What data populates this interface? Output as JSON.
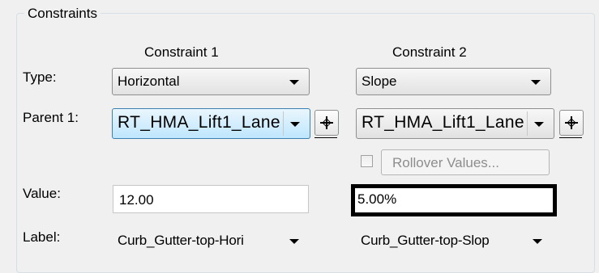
{
  "group": {
    "title": "Constraints"
  },
  "columns": {
    "c1": "Constraint 1",
    "c2": "Constraint 2"
  },
  "rows": {
    "type": {
      "label": "Type:",
      "c1": "Horizontal",
      "c2": "Slope"
    },
    "parent1": {
      "label": "Parent 1:",
      "c1": "RT_HMA_Lift1_Lanе",
      "c2": "RT_HMA_Lift1_Lanе"
    },
    "rollover": {
      "label": "Rollover Values..."
    },
    "value": {
      "label": "Value:",
      "c1": "12.00",
      "c2": "5.00%"
    },
    "label": {
      "label": "Label:",
      "c1": "Curb_Gutter-top-Hori",
      "c2": "Curb_Gutter-top-Slop"
    }
  },
  "icons": {
    "dropdown": "chevron-down-icon",
    "pick": "crosshair-pick-icon"
  }
}
